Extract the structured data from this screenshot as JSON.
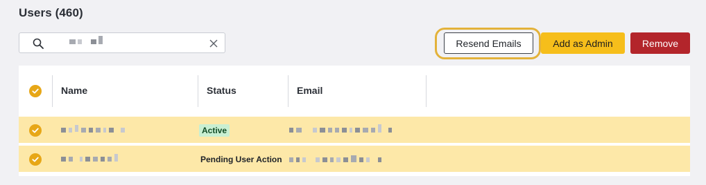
{
  "page": {
    "title": "Users (460)"
  },
  "search": {
    "placeholder": "",
    "icon": "search-icon",
    "clear_icon": "close-icon"
  },
  "actions": {
    "resend_label": "Resend Emails",
    "admin_label": "Add as Admin",
    "remove_label": "Remove"
  },
  "table": {
    "columns": [
      "Name",
      "Status",
      "Email"
    ],
    "rows": [
      {
        "status": "Active",
        "status_style": "badge",
        "selected": true
      },
      {
        "status": "Pending User Action",
        "status_style": "text",
        "selected": true
      }
    ]
  },
  "colors": {
    "accent": "#e7a717",
    "primary_button": "#f6be1b",
    "danger_button": "#b3252b",
    "selected_row": "#fde8a8",
    "active_badge": "#c9efd2"
  }
}
